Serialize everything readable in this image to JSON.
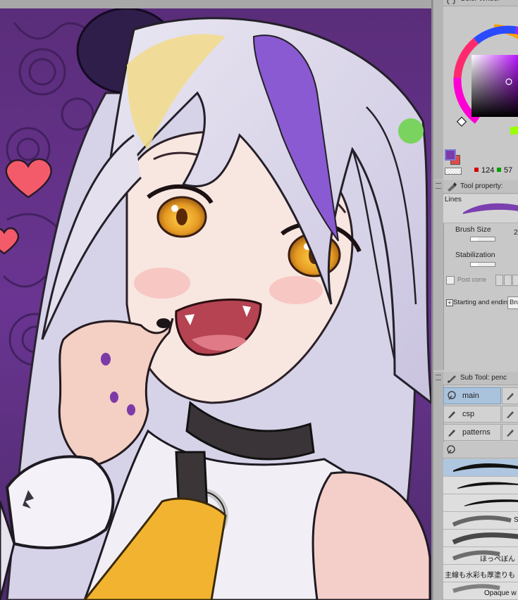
{
  "panels": {
    "color_wheel": {
      "title": "Color Wheel",
      "fg_color": "#7c3aa8",
      "bg_color": "#e44a44",
      "rgb_r": "124",
      "rgb_g": "57",
      "r_dot_color": "#d40000",
      "g_dot_color": "#00a000"
    },
    "tool_property": {
      "title": "Tool property:",
      "lines_label": "Lines",
      "brush_size_label": "Brush Size",
      "brush_size_value": "2",
      "stabilization_label": "Stabilization",
      "post_correction_label": "Post corre",
      "starting_ending_label": "Starting and ending",
      "starting_ending_value": "Bru",
      "expand_glyph": "+"
    },
    "sub_tool": {
      "title": "Sub Tool: penc",
      "groups": [
        {
          "label": "main",
          "selected": true
        },
        {
          "label": "csp",
          "selected": false
        },
        {
          "label": "patterns",
          "selected": false
        }
      ],
      "brushes": [
        {
          "label": ""
        },
        {
          "label": ""
        },
        {
          "label": ""
        },
        {
          "label": "S"
        },
        {
          "label": ""
        },
        {
          "label": "ほっぺぼん"
        },
        {
          "label": "主線も水彩も厚塗りも"
        },
        {
          "label": "Opaque w"
        }
      ]
    }
  },
  "icons": {
    "panel_grip": "grip-icon",
    "tool_property_icon": "pen-tool-icon",
    "sub_tool_icon": "pencil-icon",
    "group_icon": "brush-group-icon"
  }
}
